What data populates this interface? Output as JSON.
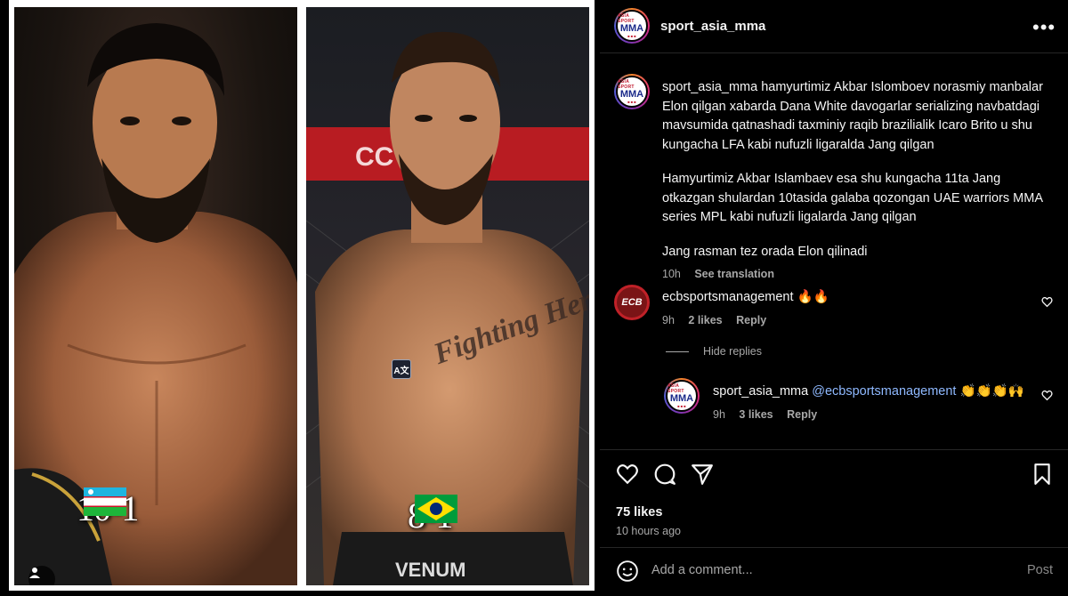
{
  "post": {
    "username": "sport_asia_mma",
    "more_label": "•••",
    "caption_p1": "hamyurtimiz Akbar Islomboev norasmiy manbalar Elon qilgan xabarda Dana White davogarlar serializing navbatdagi mavsumida qatnashadi taxminiy raqib brazilialik Icaro Brito u shu kungacha LFA kabi nufuzli ligaralda Jang qilgan",
    "caption_p2": "Hamyurtimiz Akbar Islambaev esa shu kungacha 11ta Jang otkazgan shulardan 10tasida galaba qozongan UAE warriors MMA series MPL kabi nufuzli ligalarda Jang qilgan",
    "caption_p3": "Jang rasman tez orada Elon qilinadi",
    "caption_time": "10h",
    "see_translation": "See translation",
    "likes": "75 likes",
    "time_ago": "10 hours ago"
  },
  "logo": {
    "top": "ASIA SPORT",
    "mid": "MMA",
    "bot": "■ ■ ■"
  },
  "images": {
    "left_record": "10-1",
    "right_record": "8-1",
    "translate_badge": "A文",
    "tattoo_text": "Fighting Hero",
    "shorts_brand": "VENUM",
    "banner_text": "CC PP"
  },
  "comments": [
    {
      "username": "ecbsportsmanagement",
      "avatar_text": "ECB",
      "text": "🔥🔥",
      "time": "9h",
      "likes": "2 likes",
      "reply_label": "Reply"
    }
  ],
  "hide_replies_label": "Hide replies",
  "replies": [
    {
      "username": "sport_asia_mma",
      "mention": "@ecbsportsmanagement",
      "text": "👏👏👏🙌",
      "time": "9h",
      "likes": "3 likes",
      "reply_label": "Reply"
    }
  ],
  "comment_bar": {
    "placeholder": "Add a comment...",
    "post_label": "Post"
  },
  "colors": {
    "bg": "#000000",
    "muted": "#a8a8a8",
    "divider": "#262626",
    "link": "#8fb9ff"
  },
  "icons": [
    "heart-icon",
    "comment-icon",
    "share-icon",
    "bookmark-icon",
    "emoji-icon",
    "more-icon"
  ]
}
